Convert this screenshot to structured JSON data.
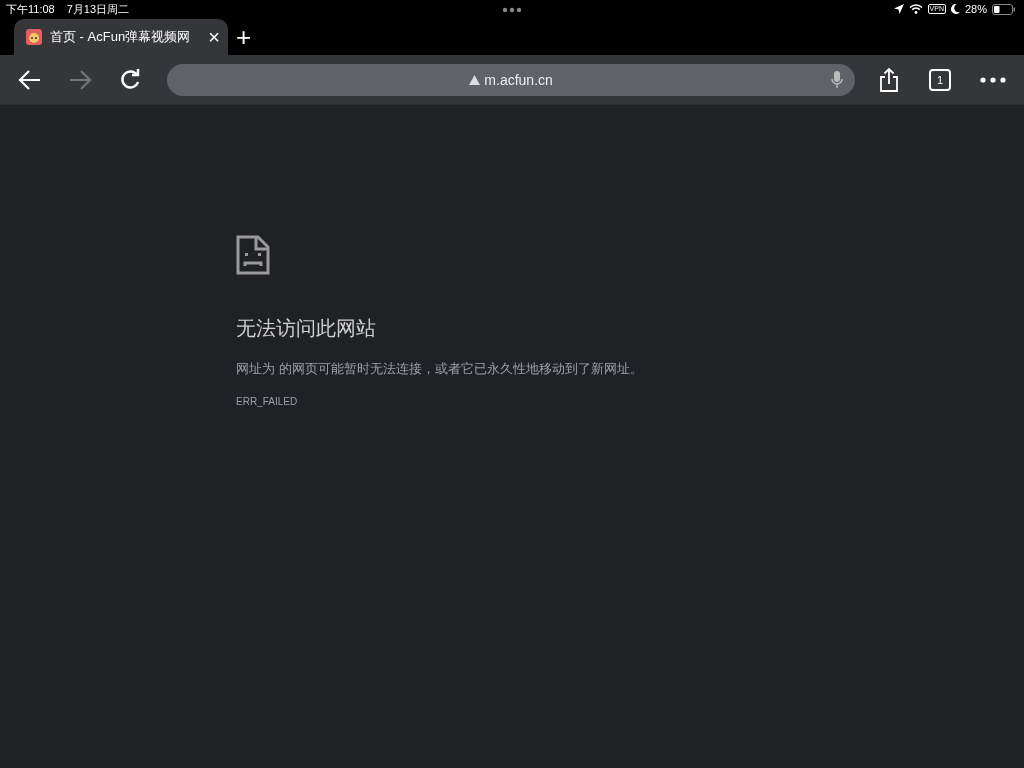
{
  "status_bar": {
    "time": "下午11:08",
    "date": "7月13日周二",
    "vpn": "VPN",
    "battery": "28%"
  },
  "tabs": [
    {
      "title": "首页 - AcFun弹幕视频网",
      "selected": true,
      "close": "×"
    }
  ],
  "new_tab": "+",
  "toolbar": {
    "back_disabled": false,
    "forward_disabled": true,
    "address": "m.acfun.cn",
    "tab_count": "1"
  },
  "error": {
    "title": "无法访问此网站",
    "message": "网址为 的网页可能暂时无法连接，或者它已永久性地移动到了新网址。",
    "code": "ERR_FAILED"
  }
}
